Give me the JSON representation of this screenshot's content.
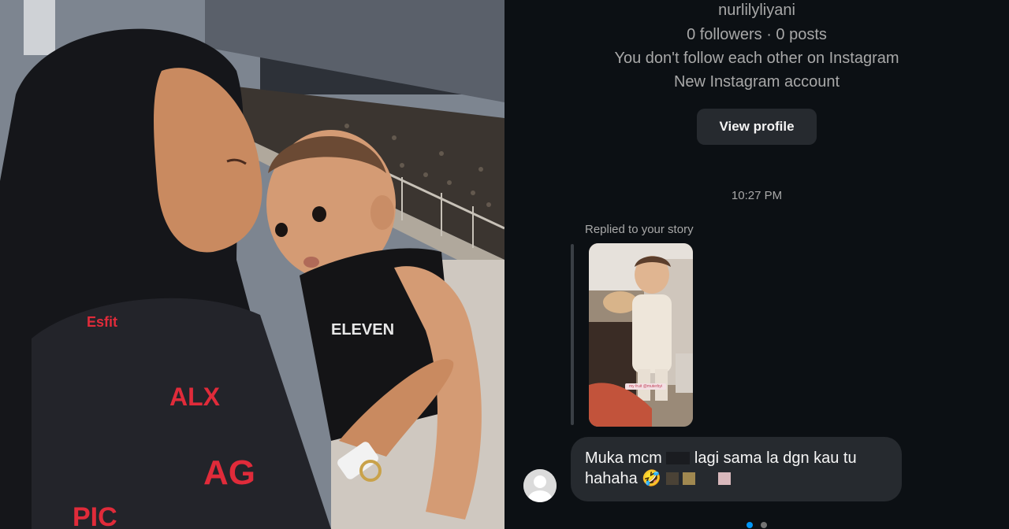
{
  "profile": {
    "username": "nurlilyliyani",
    "stats": "0 followers · 0 posts",
    "follow_status": "You don't follow each other on Instagram",
    "account_note": "New Instagram account",
    "view_profile_label": "View profile"
  },
  "thread": {
    "timestamp": "10:27 PM",
    "reply_context": "Replied to your story",
    "story_sticker_text": "my fruit @muterbyi",
    "message": {
      "line1_part1": "Muka mcm",
      "line1_part2": "lagi sama la dgn kau tu",
      "line2_text": "hahaha",
      "emoji": "🤣"
    }
  },
  "carousel": {
    "total": 2,
    "active": 1
  },
  "photo": {
    "jersey_text_1": "ALX",
    "jersey_text_2": "AG",
    "jersey_text_3": "PIC",
    "jersey_text_4": "Esfit",
    "tank_text": "ELEVEN"
  },
  "colors": {
    "background": "#0c1014",
    "bubble": "#262a2f",
    "text_primary": "#f5f5f5",
    "text_secondary": "#a8a8a8",
    "dot_active": "#0095f6",
    "dot_inactive": "#737373",
    "jersey_accent": "#e02b3a"
  }
}
